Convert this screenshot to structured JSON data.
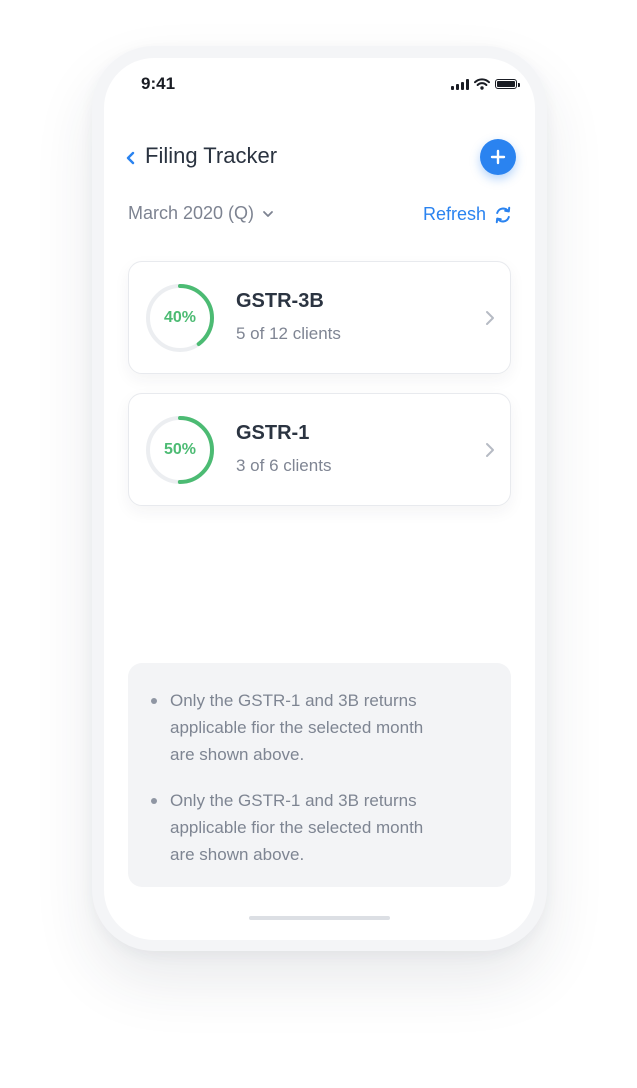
{
  "status_bar": {
    "time": "9:41"
  },
  "header": {
    "title": "Filing Tracker"
  },
  "filters": {
    "period": "March 2020 (Q)",
    "refresh_label": "Refresh"
  },
  "cards": [
    {
      "percent_label": "40%",
      "progress": 0.4,
      "title": "GSTR-3B",
      "subtitle": "5 of 12 clients"
    },
    {
      "percent_label": "50%",
      "progress": 0.5,
      "title": "GSTR-1",
      "subtitle": "3 of 6 clients"
    }
  ],
  "notes": [
    {
      "line1": "Only the GSTR-1 and 3B returns",
      "line2": "applicable fior the selected month",
      "line3": "are shown above."
    },
    {
      "line1": "Only the GSTR-1 and 3B returns",
      "line2": "applicable fior the selected month",
      "line3": "are shown above."
    }
  ],
  "colors": {
    "accent": "#2a83f0",
    "progress": "#4cbb73",
    "track": "#eceef1"
  },
  "icons": [
    "back-chevron-icon",
    "plus-icon",
    "chevron-down-icon",
    "refresh-icon",
    "chevron-right-icon"
  ]
}
